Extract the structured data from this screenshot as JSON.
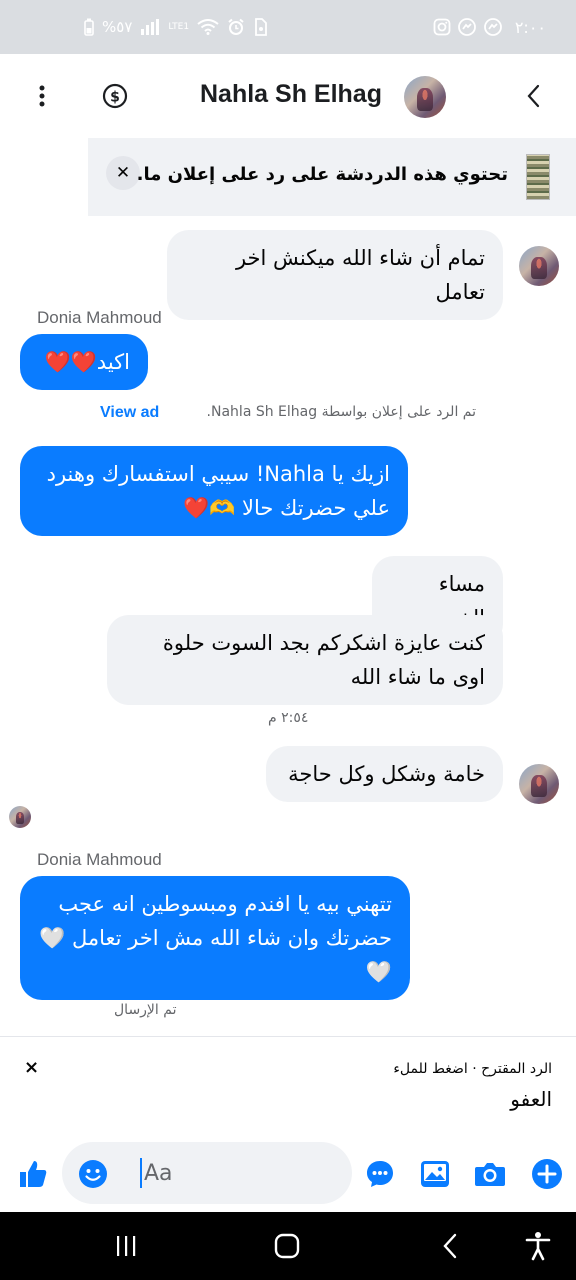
{
  "status_bar": {
    "time": "٢:٠٠",
    "battery": "%٥٧",
    "network": "LTE1"
  },
  "header": {
    "title": "Nahla Sh Elhag"
  },
  "ad_notice": {
    "text": "تحتوي هذه الدردشة على رد على إعلان ما."
  },
  "messages": [
    {
      "id": "m1",
      "text": "تمام أن شاء الله ميكنش اخر تعامل"
    },
    {
      "id": "m2",
      "sender": "Donia Mahmoud",
      "text": "اكيد❤️❤️"
    },
    {
      "id": "m3",
      "text": "ازيك يا Nahla!  سيبي استفسارك وهنرد علي حضرتك حالا 🫶❤️"
    },
    {
      "id": "m4",
      "text": "مساء الخير"
    },
    {
      "id": "m5",
      "text": "كنت عايزة اشكركم بجد السوت حلوة اوى ما شاء الله"
    },
    {
      "id": "m6",
      "text": "خامة وشكل وكل حاجة"
    },
    {
      "id": "m7",
      "sender": "Donia Mahmoud",
      "text": "تتهني بيه يا افندم ومبسوطين انه عجب حضرتك وان شاء الله مش اخر تعامل 🤍🤍"
    }
  ],
  "ad_reply_note": {
    "text": "تم الرد على إعلان بواسطة Nahla Sh Elhag.",
    "link": "View ad"
  },
  "timestamp": "٢:٥٤ م",
  "sent_status": "تم الإرسال",
  "suggested_reply": {
    "label": "الرد المقترح · اضغط للملء",
    "text": "العفو"
  },
  "composer": {
    "placeholder": "Aa"
  },
  "colors": {
    "accent": "#0a7cff",
    "incoming_bubble": "#f0f2f5",
    "status_bar": "#dadde1"
  }
}
